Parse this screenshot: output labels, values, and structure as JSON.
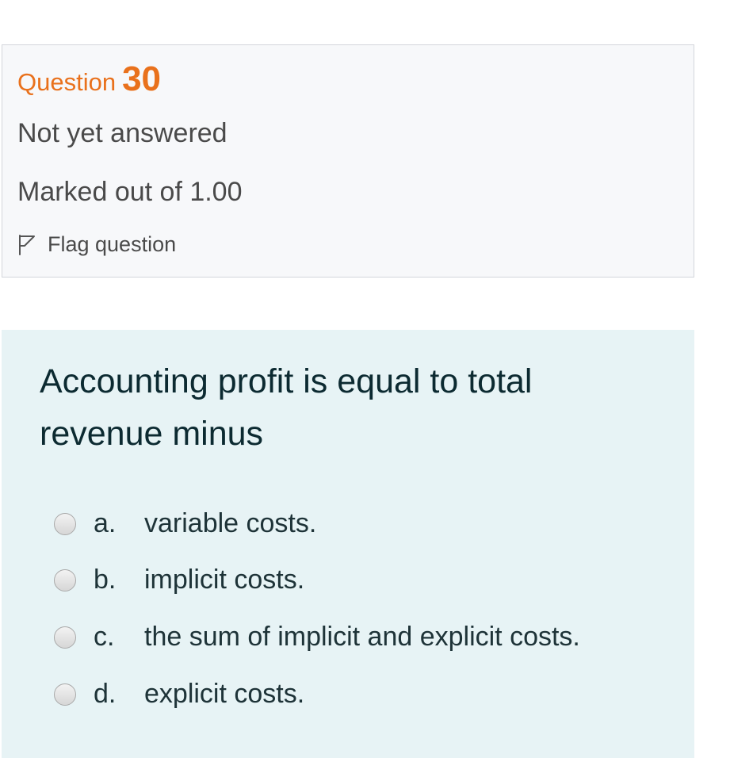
{
  "question_info": {
    "label": "Question",
    "number": "30",
    "state": "Not yet answered",
    "grade": "Marked out of 1.00",
    "flag_label": "Flag question",
    "flag_icon": "flag-outline-icon"
  },
  "question": {
    "text": "Accounting profit is equal to total revenue minus",
    "answers": [
      {
        "letter": "a.",
        "text": "variable costs.",
        "selected": false
      },
      {
        "letter": "b.",
        "text": "implicit costs.",
        "selected": false
      },
      {
        "letter": "c.",
        "text": "the sum of implicit and explicit costs.",
        "selected": false
      },
      {
        "letter": "d.",
        "text": "explicit costs.",
        "selected": false
      }
    ]
  },
  "colors": {
    "accent": "#e9711c",
    "info_background": "#f7f8fa",
    "content_background": "#e7f3f5",
    "text": "#4a4a4a",
    "question_text": "#0c2a31"
  }
}
